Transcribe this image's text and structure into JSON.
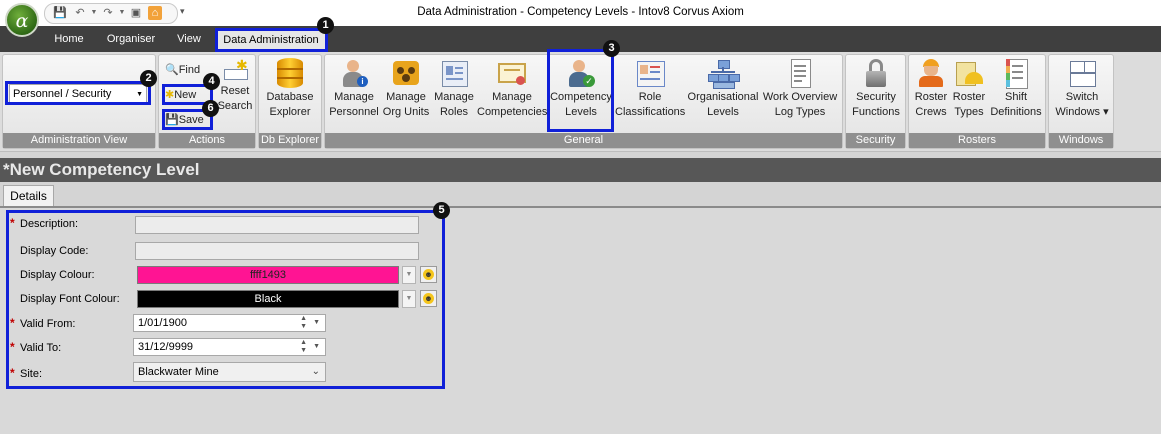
{
  "app": {
    "orb_glyph": "α",
    "window_title": "Data Administration - Competency Levels - Intov8 Corvus Axiom"
  },
  "tabs": [
    {
      "label": "Home"
    },
    {
      "label": "Organiser"
    },
    {
      "label": "View"
    },
    {
      "label": "Data Administration",
      "active": true
    }
  ],
  "ribbon": {
    "admin_view": {
      "selected": "Personnel / Security",
      "group_label": "Administration View"
    },
    "actions": {
      "find": "Find",
      "new": "New",
      "save": "Save",
      "reset": "Reset",
      "search": "Search",
      "group_label": "Actions"
    },
    "db_explorer": {
      "line1": "Database",
      "line2": "Explorer",
      "group_label": "Db Explorer"
    },
    "general": {
      "group_label": "General",
      "buttons": [
        {
          "line1": "Manage",
          "line2": "Personnel",
          "icon": "personnel-icon"
        },
        {
          "line1": "Manage",
          "line2": "Org Units",
          "icon": "org-units-icon"
        },
        {
          "line1": "Manage",
          "line2": "Roles",
          "icon": "roles-icon"
        },
        {
          "line1": "Manage",
          "line2": "Competencies",
          "icon": "competencies-icon"
        },
        {
          "line1": "Competency",
          "line2": "Levels",
          "icon": "competency-levels-icon"
        },
        {
          "line1": "Role",
          "line2": "Classifications",
          "icon": "role-classifications-icon"
        },
        {
          "line1": "Organisational",
          "line2": "Levels",
          "icon": "org-levels-icon"
        },
        {
          "line1": "Work Overview",
          "line2": "Log Types",
          "icon": "log-types-icon"
        }
      ]
    },
    "security": {
      "line1": "Security",
      "line2": "Functions",
      "group_label": "Security"
    },
    "rosters": {
      "group_label": "Rosters",
      "buttons": [
        {
          "line1": "Roster",
          "line2": "Crews"
        },
        {
          "line1": "Roster",
          "line2": "Types"
        },
        {
          "line1": "Shift",
          "line2": "Definitions"
        }
      ]
    },
    "windows": {
      "line1": "Switch",
      "line2": "Windows ▾",
      "group_label": "Windows"
    }
  },
  "document": {
    "title": "*New Competency Level",
    "subtab": "Details"
  },
  "form": {
    "description": {
      "label": "Description:",
      "value": ""
    },
    "display_code": {
      "label": "Display Code:",
      "value": ""
    },
    "display_colour": {
      "label": "Display Colour:",
      "value": "ffff1493",
      "color": "#ff1493"
    },
    "display_font_colour": {
      "label": "Display Font Colour:",
      "value": "Black",
      "color": "#000000"
    },
    "valid_from": {
      "label": "Valid From:",
      "value": "1/01/1900"
    },
    "valid_to": {
      "label": "Valid To:",
      "value": "31/12/9999"
    },
    "site": {
      "label": "Site:",
      "value": "Blackwater Mine"
    },
    "required_marker": "*"
  },
  "callouts": [
    "1",
    "2",
    "3",
    "4",
    "5",
    "6"
  ],
  "colors": {
    "highlight": "#1020d8",
    "required": "#c00000",
    "tabbar": "#3f3f3f"
  }
}
